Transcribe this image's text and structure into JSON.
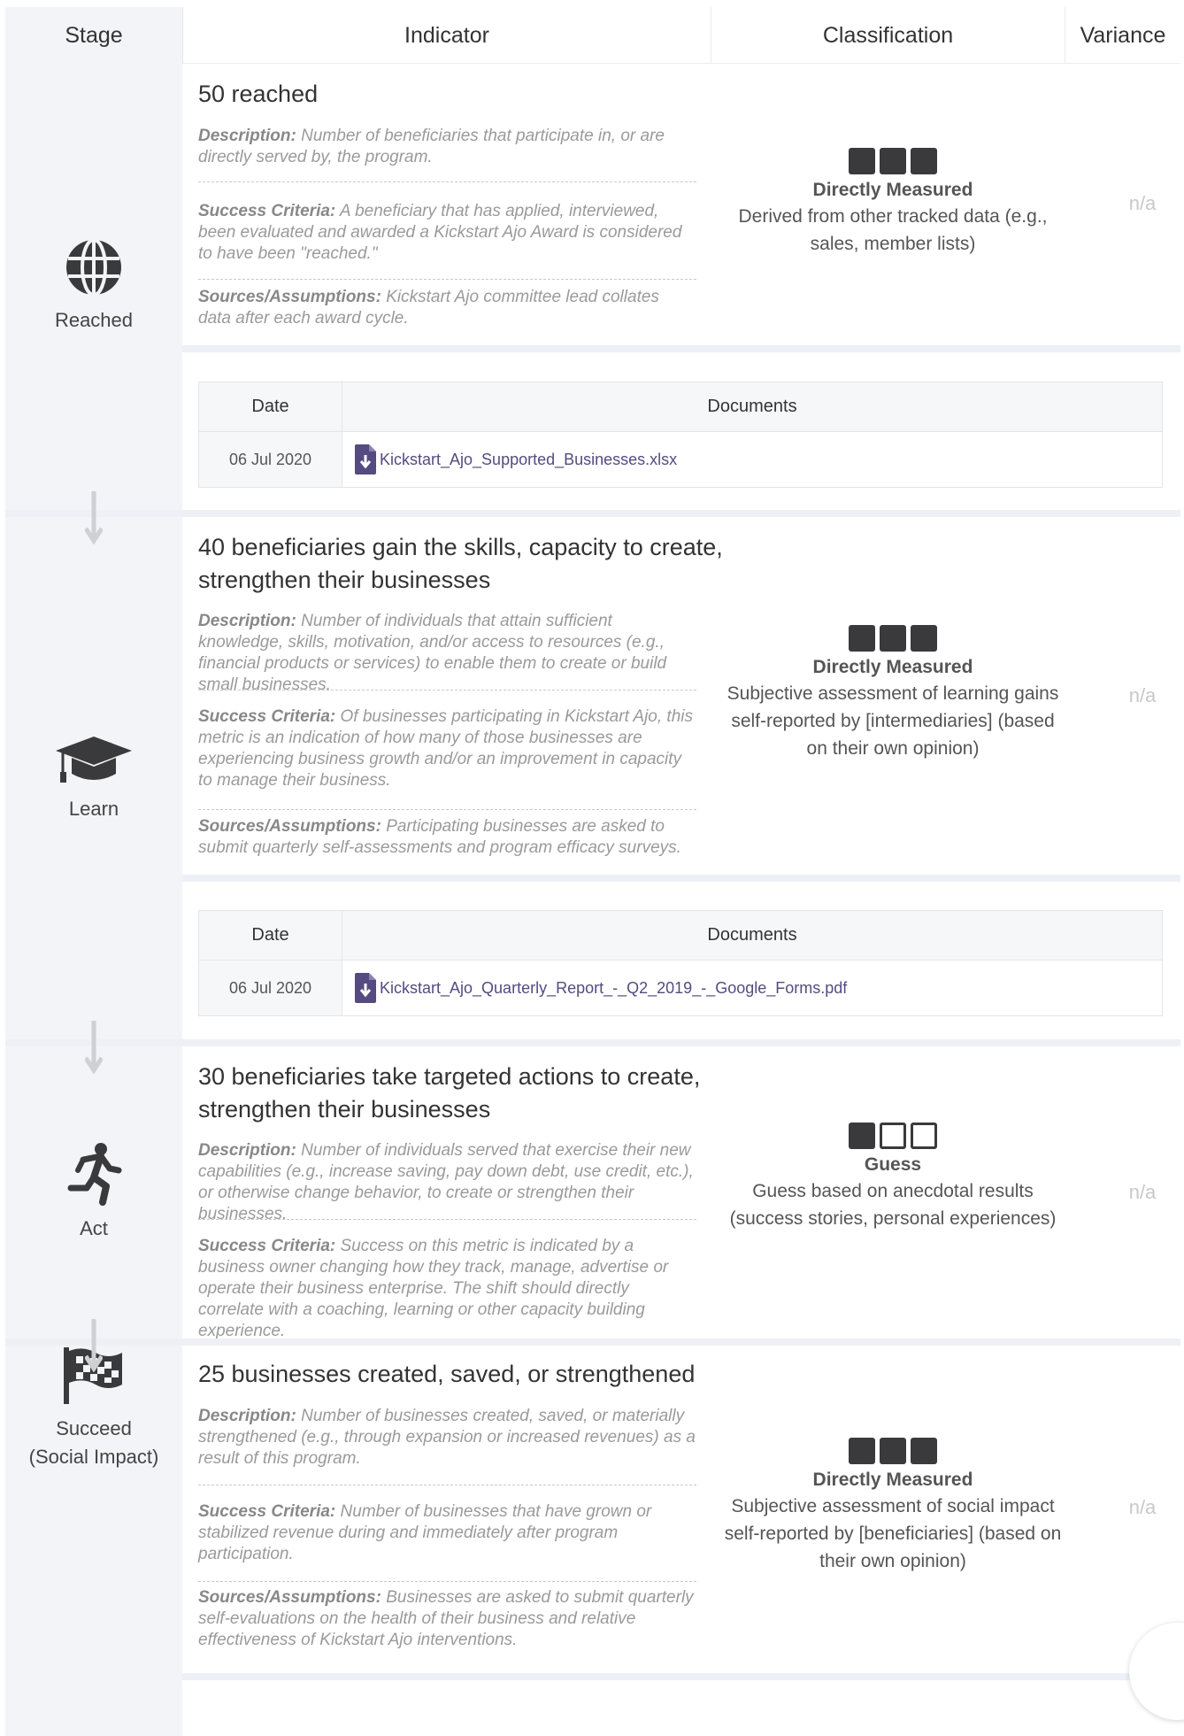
{
  "header": {
    "stage": "Stage",
    "indicator": "Indicator",
    "classification": "Classification",
    "variance": "Variance"
  },
  "rows": [
    {
      "stage": "Reached",
      "icon": "globe-icon",
      "title": "50 reached",
      "description_label": "Description:",
      "description": "Number of beneficiaries that participate in, or are directly served by, the program.",
      "success_label": "Success Criteria:",
      "success": "A beneficiary that has applied, interviewed, been evaluated and awarded a Kickstart Ajo Award is considered to have been \"reached.\"",
      "sources_label": "Sources/Assumptions:",
      "sources": "Kickstart Ajo committee lead collates data after each award cycle.",
      "classification_name": "Directly Measured",
      "classification_desc": "Derived from other tracked data (e.g., sales, member lists)",
      "classification_level": 3,
      "variance": "n/a",
      "docs": {
        "date_header": "Date",
        "docs_header": "Documents",
        "date": "06 Jul 2020",
        "file": "Kickstart_Ajo_Supported_Businesses.xlsx"
      }
    },
    {
      "stage": "Learn",
      "icon": "graduation-cap-icon",
      "title": "40 beneficiaries gain the skills, capacity to create, strengthen their businesses",
      "description_label": "Description:",
      "description": "Number of individuals that attain sufficient knowledge, skills, motivation, and/or access to resources (e.g., financial products or services) to enable them to create or build small businesses.",
      "success_label": "Success Criteria:",
      "success": "Of businesses participating in Kickstart Ajo, this metric is an indication of how many of those businesses are experiencing business growth and/or an improvement in capacity to manage their business.",
      "sources_label": "Sources/Assumptions:",
      "sources": "Participating businesses are asked to submit quarterly self-assessments and program efficacy surveys.",
      "classification_name": "Directly Measured",
      "classification_desc": "Subjective assessment of learning gains self-reported by [intermediaries] (based on their own opinion)",
      "classification_level": 3,
      "variance": "n/a",
      "docs": {
        "date_header": "Date",
        "docs_header": "Documents",
        "date": "06 Jul 2020",
        "file": "Kickstart_Ajo_Quarterly_Report_-_Q2_2019_-_Google_Forms.pdf"
      }
    },
    {
      "stage": "Act",
      "icon": "running-person-icon",
      "title": "30 beneficiaries take targeted actions to create, strengthen their businesses",
      "description_label": "Description:",
      "description": "Number of individuals served that exercise their new capabilities (e.g., increase saving, pay down debt, use credit, etc.), or otherwise change behavior, to create or strengthen their businesses.",
      "success_label": "Success Criteria:",
      "success": "Success on this metric is indicated by a business owner changing how they track, manage, advertise or operate their business enterprise. The shift should directly correlate with a coaching, learning or other capacity building experience.",
      "classification_name": "Guess",
      "classification_desc": "Guess based on anecdotal results (success stories, personal experiences)",
      "classification_level": 1,
      "variance": "n/a"
    },
    {
      "stage": "Succeed",
      "stage2": "(Social Impact)",
      "icon": "checkered-flag-icon",
      "title": "25 businesses created, saved, or strengthened",
      "description_label": "Description:",
      "description": "Number of businesses created, saved, or materially strengthened (e.g., through expansion or increased revenues) as a result of this program.",
      "success_label": "Success Criteria:",
      "success": "Number of businesses that have grown or stabilized revenue during and immediately after program participation.",
      "sources_label": "Sources/Assumptions:",
      "sources": "Businesses are asked to submit quarterly self-evaluations on the health of their business and relative effectiveness of Kickstart Ajo interventions.",
      "classification_name": "Directly Measured",
      "classification_desc": "Subjective assessment of social impact self-reported by [beneficiaries] (based on their own opinion)",
      "classification_level": 3,
      "variance": "n/a"
    }
  ]
}
